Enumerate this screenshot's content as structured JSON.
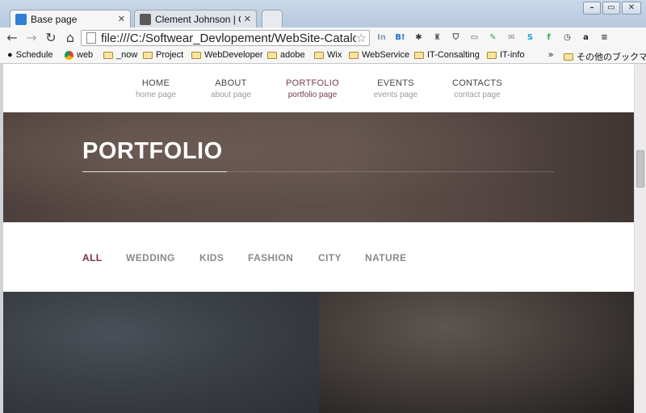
{
  "browser": {
    "tabs": [
      {
        "title": "Base page",
        "favicon_color": "#2f80d3",
        "active": true
      },
      {
        "title": "Clement Johnson | One p",
        "favicon_color": "#5a5a5a",
        "active": false
      }
    ],
    "url": "file:///C:/Softwear_Devlopement/WebSite-Catalo",
    "window_controls": [
      "–",
      "▭",
      "✕"
    ]
  },
  "bookmarks": [
    {
      "label": "Schedule"
    },
    {
      "label": "web"
    },
    {
      "label": "_now"
    },
    {
      "label": "Project"
    },
    {
      "label": "WebDeveloper"
    },
    {
      "label": "adobe"
    },
    {
      "label": "Wix"
    },
    {
      "label": "WebService"
    },
    {
      "label": "IT-Consalting"
    },
    {
      "label": "IT-info"
    },
    {
      "label": "»"
    },
    {
      "label": "その他のブックマーク"
    }
  ],
  "extensions": [
    {
      "name": "in-icon",
      "glyph": "In",
      "color": "#8a9bb0"
    },
    {
      "name": "hatena-bookmark-icon",
      "glyph": "B!",
      "color": "#1d6fc8"
    },
    {
      "name": "gear-puzzle-icon",
      "glyph": "✱",
      "color": "#333"
    },
    {
      "name": "stamp-icon",
      "glyph": "♜",
      "color": "#555"
    },
    {
      "name": "pocket-icon",
      "glyph": "⛉",
      "color": "#444"
    },
    {
      "name": "cast-icon",
      "glyph": "▭",
      "color": "#555"
    },
    {
      "name": "evernote-icon",
      "glyph": "✎",
      "color": "#3aa63a"
    },
    {
      "name": "translate-icon",
      "glyph": "✉",
      "color": "#888"
    },
    {
      "name": "skype-icon",
      "glyph": "S",
      "color": "#12a5e0"
    },
    {
      "name": "feedly-icon",
      "glyph": "f",
      "color": "#2bb24c"
    },
    {
      "name": "clock-icon",
      "glyph": "◷",
      "color": "#333"
    },
    {
      "name": "amazon-icon",
      "glyph": "a",
      "color": "#222"
    },
    {
      "name": "menu-icon",
      "glyph": "≡",
      "color": "#333"
    }
  ],
  "site": {
    "nav": [
      {
        "label": "HOME",
        "sub": "home page",
        "active": false
      },
      {
        "label": "ABOUT",
        "sub": "about page",
        "active": false
      },
      {
        "label": "PORTFOLIO",
        "sub": "portfolio page",
        "active": true
      },
      {
        "label": "EVENTS",
        "sub": "events page",
        "active": false
      },
      {
        "label": "CONTACTS",
        "sub": "contact page",
        "active": false
      }
    ],
    "hero_title": "PORTFOLIO",
    "filters": [
      {
        "label": "ALL",
        "active": true
      },
      {
        "label": "WEDDING",
        "active": false
      },
      {
        "label": "KIDS",
        "active": false
      },
      {
        "label": "FASHION",
        "active": false
      },
      {
        "label": "CITY",
        "active": false
      },
      {
        "label": "NATURE",
        "active": false
      }
    ]
  }
}
